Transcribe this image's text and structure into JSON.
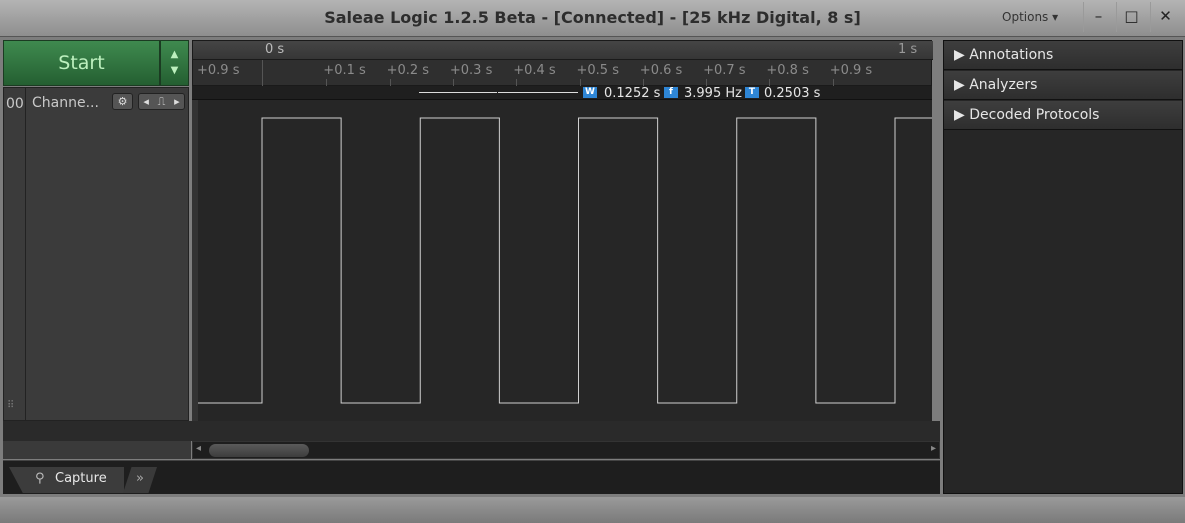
{
  "window": {
    "title": "Saleae Logic 1.2.5 Beta - [Connected] - [25 kHz Digital, 8 s]",
    "options_label": "Options ▾",
    "minimize": "–",
    "maximize": "□",
    "close": "✕"
  },
  "capture": {
    "start_label": "Start",
    "up": "▲",
    "down": "▼"
  },
  "channel": {
    "index": "00",
    "name": "Channe...",
    "gear": "⚙",
    "prev": "◂",
    "pulse": "⎍",
    "next": "▸",
    "grip": "⠿"
  },
  "ruler": {
    "top_labels": [
      "0 s",
      "1 s"
    ],
    "left_label": "+0.9 s",
    "tick_labels": [
      "+0.1 s",
      "+0.2 s",
      "+0.3 s",
      "+0.4 s",
      "+0.5 s",
      "+0.6 s",
      "+0.7 s",
      "+0.8 s",
      "+0.9 s"
    ]
  },
  "measurements": {
    "width_badge": "W",
    "width": "0.1252 s",
    "freq_badge": "f",
    "frequency": "3.995 Hz",
    "period_badge": "T",
    "period": "0.2503 s"
  },
  "waveform": {
    "high_intervals_s": [
      [
        0,
        0.125
      ],
      [
        0.25,
        0.375
      ],
      [
        0.5,
        0.625
      ],
      [
        0.75,
        0.875
      ],
      [
        1.0,
        1.06
      ]
    ]
  },
  "tabs": {
    "capture": "Capture",
    "more": "»"
  },
  "sidebar": {
    "sections": [
      "Annotations",
      "Analyzers",
      "Decoded Protocols"
    ],
    "expand_icon": "▶"
  },
  "colors": {
    "start_green": "#2f7a3e",
    "badge_blue": "#2e86d6",
    "waveform": "#d0d0d0"
  }
}
